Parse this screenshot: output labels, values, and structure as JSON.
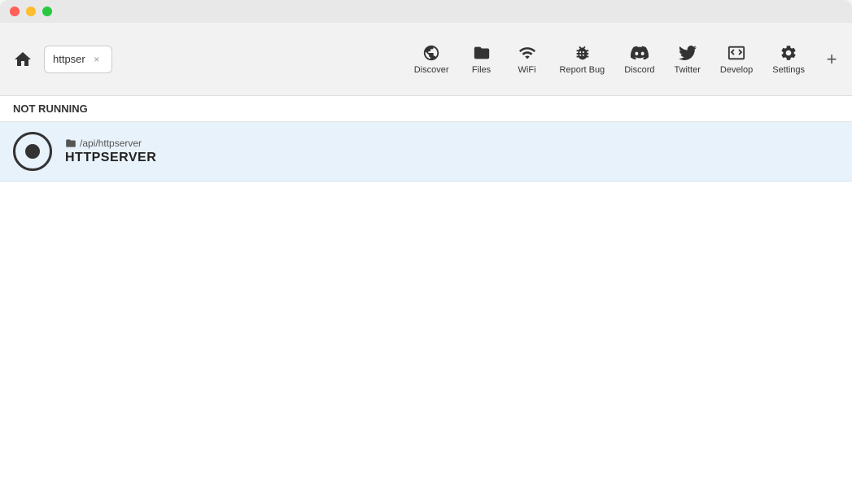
{
  "titleBar": {
    "trafficLights": [
      "close",
      "minimize",
      "maximize"
    ]
  },
  "toolbar": {
    "homeLabel": "home",
    "tab": {
      "label": "httpser",
      "closeLabel": "×"
    },
    "navItems": [
      {
        "id": "discover",
        "label": "Discover",
        "icon": "globe"
      },
      {
        "id": "files",
        "label": "Files",
        "icon": "folder"
      },
      {
        "id": "wifi",
        "label": "WiFi",
        "icon": "wifi"
      },
      {
        "id": "report-bug",
        "label": "Report Bug",
        "icon": "bug"
      },
      {
        "id": "discord",
        "label": "Discord",
        "icon": "discord"
      },
      {
        "id": "twitter",
        "label": "Twitter",
        "icon": "twitter"
      },
      {
        "id": "develop",
        "label": "Develop",
        "icon": "develop"
      },
      {
        "id": "settings",
        "label": "Settings",
        "icon": "settings"
      }
    ],
    "addButton": "+"
  },
  "statusBar": {
    "text": "NOT RUNNING"
  },
  "serverList": [
    {
      "path": "/api/httpserver",
      "name": "HTTPSERVER"
    }
  ]
}
